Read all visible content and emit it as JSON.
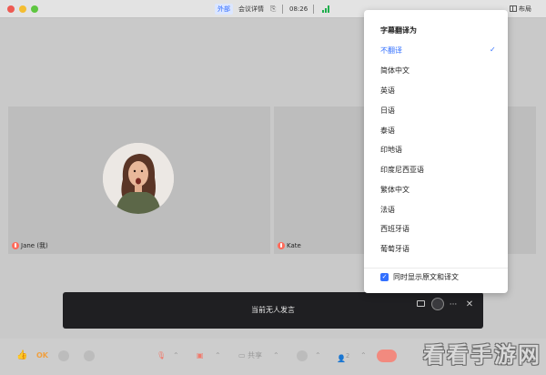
{
  "titlebar": {
    "external_tag": "外部",
    "meeting_details": "会议详情",
    "time": "08:26",
    "layout_label": "布局"
  },
  "participants": [
    {
      "name": "Jane (我)",
      "mic": "muted"
    },
    {
      "name": "Kate",
      "mic": "muted"
    }
  ],
  "caption": {
    "status_text": "当前无人发言"
  },
  "translate_menu": {
    "title": "字幕翻译为",
    "options": [
      "不翻译",
      "简体中文",
      "英语",
      "日语",
      "泰语",
      "印地语",
      "印度尼西亚语",
      "繁体中文",
      "法语",
      "西班牙语",
      "葡萄牙语"
    ],
    "selected": "不翻译",
    "bilingual_label": "同时显示原文和译文",
    "bilingual_checked": true,
    "check_mark": "✓"
  },
  "toolbar": {
    "ok_label": "OK",
    "share_label": "共享",
    "participant_count": "2"
  },
  "colors": {
    "accent": "#3370ff",
    "caption_bg": "#1f1f22",
    "hangup": "#f28a7f"
  },
  "watermark": "看看手游网"
}
